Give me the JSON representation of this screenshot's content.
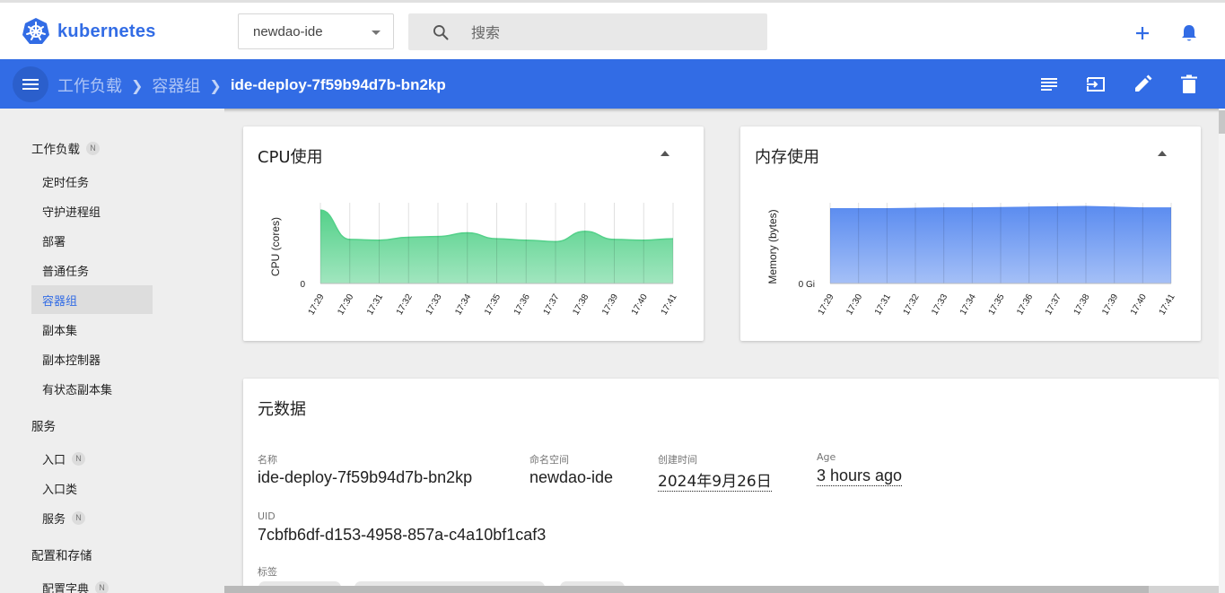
{
  "app": {
    "name": "kubernetes"
  },
  "namespace": {
    "selected": "newdao-ide"
  },
  "search": {
    "placeholder": "搜索"
  },
  "breadcrumb": {
    "items": [
      "工作负载",
      "容器组"
    ],
    "current": "ide-deploy-7f59b94d7b-bn2kp"
  },
  "sidebar": {
    "sections": [
      {
        "label": "工作负载",
        "badge": "N"
      },
      {
        "label": "服务"
      },
      {
        "label": "配置和存储"
      }
    ],
    "workload_items": [
      "定时任务",
      "守护进程组",
      "部署",
      "普通任务",
      "容器组",
      "副本集",
      "副本控制器",
      "有状态副本集"
    ],
    "service_items": [
      {
        "label": "入口",
        "badge": "N"
      },
      {
        "label": "入口类"
      },
      {
        "label": "服务",
        "badge": "N"
      }
    ],
    "config_items": [
      {
        "label": "配置字典",
        "badge": "N"
      }
    ],
    "active": "容器组"
  },
  "cpu_card": {
    "title": "CPU使用"
  },
  "mem_card": {
    "title": "内存使用"
  },
  "metadata_card": {
    "title": "元数据",
    "name_label": "名称",
    "name_value": "ide-deploy-7f59b94d7b-bn2kp",
    "ns_label": "命名空间",
    "ns_value": "newdao-ide",
    "created_label": "创建时间",
    "created_value": "2024年9月26日",
    "age_label": "Age",
    "age_value": "3 hours ago",
    "uid_label": "UID",
    "uid_value": "7cbfb6df-d153-4958-857a-c4a10bf1caf3",
    "labels_label": "标签"
  },
  "colors": {
    "brand": "#326ce5",
    "cpu_fill": "#54d18a",
    "mem_fill": "#5b8cf0"
  },
  "chart_data": [
    {
      "type": "area",
      "x": [
        "17:29",
        "17:30",
        "17:31",
        "17:32",
        "17:33",
        "17:34",
        "17:35",
        "17:36",
        "17:37",
        "17:38",
        "17:39",
        "17:40",
        "17:41"
      ],
      "series": [
        {
          "values": [
            1.0,
            0.6,
            0.59,
            0.63,
            0.64,
            0.69,
            0.61,
            0.59,
            0.57,
            0.71,
            0.6,
            0.59,
            0.61
          ]
        }
      ],
      "ylabel": "CPU (cores)",
      "yticks": [
        "0"
      ],
      "ylim": [
        0,
        1.1
      ]
    },
    {
      "type": "area",
      "x": [
        "17:29",
        "17:30",
        "17:31",
        "17:32",
        "17:33",
        "17:34",
        "17:35",
        "17:36",
        "17:37",
        "17:38",
        "17:39",
        "17:40",
        "17:41"
      ],
      "series": [
        {
          "values": [
            0.99,
            0.99,
            0.99,
            0.995,
            1.0,
            1.0,
            1.005,
            1.01,
            1.015,
            1.02,
            1.01,
            1.0,
            1.0
          ]
        }
      ],
      "ylabel": "Memory (bytes)",
      "yticks": [
        "0 Gi"
      ],
      "ylim": [
        0,
        1.07
      ]
    }
  ]
}
